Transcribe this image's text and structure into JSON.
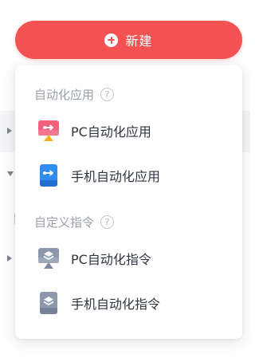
{
  "new_button": {
    "label": "新建",
    "icon": "plus-circle-icon"
  },
  "menu": {
    "sections": [
      {
        "title": "自动化应用",
        "help_icon": "question-circle-icon",
        "items": [
          {
            "label": "PC自动化应用",
            "icon": "pc-app-icon"
          },
          {
            "label": "手机自动化应用",
            "icon": "mobile-app-icon"
          }
        ]
      },
      {
        "title": "自定义指令",
        "help_icon": "question-circle-icon",
        "items": [
          {
            "label": "PC自动化指令",
            "icon": "pc-command-icon"
          },
          {
            "label": "手机自动化指令",
            "icon": "mobile-command-icon"
          }
        ]
      }
    ]
  },
  "help_glyph": "?",
  "colors": {
    "primary": "#f55353",
    "section_title": "#9aa0aa",
    "item_text": "#2f3540",
    "app_pink": "#f2607a",
    "app_orange": "#ffb020",
    "app_blue": "#2f8cf0",
    "command_gray": "#8d98ac"
  }
}
